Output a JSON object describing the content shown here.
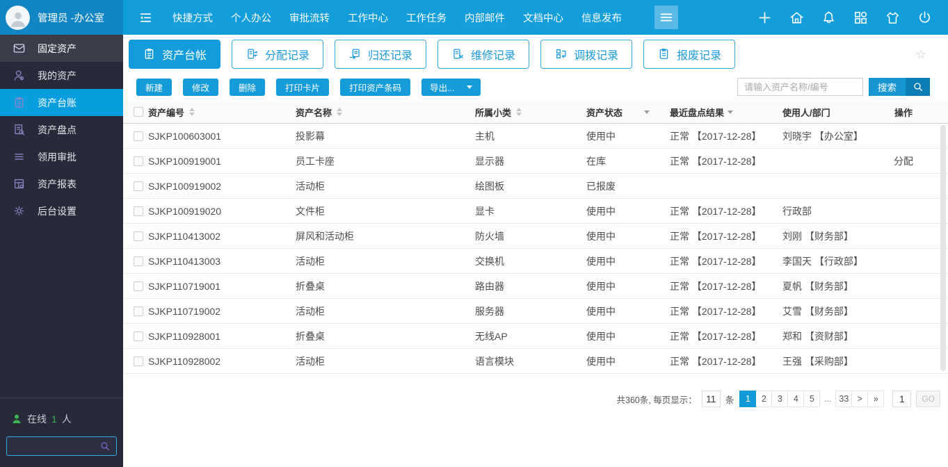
{
  "header": {
    "user_label": "管理员 -办公室",
    "nav": [
      "快捷方式",
      "个人办公",
      "审批流转",
      "工作中心",
      "工作任务",
      "内部邮件",
      "文档中心",
      "信息发布"
    ]
  },
  "sidebar": {
    "items": [
      {
        "label": "固定资产",
        "icon": "mail",
        "header": true
      },
      {
        "label": "我的资产",
        "icon": "user"
      },
      {
        "label": "资产台账",
        "icon": "ledger",
        "active": true
      },
      {
        "label": "资产盘点",
        "icon": "inventory"
      },
      {
        "label": "领用审批",
        "icon": "approval"
      },
      {
        "label": "资产报表",
        "icon": "report"
      },
      {
        "label": "后台设置",
        "icon": "gear"
      }
    ],
    "online_prefix": "在线",
    "online_count": "1",
    "online_suffix": "人"
  },
  "tabs": [
    {
      "label": "资产台帐",
      "icon": "tab-ledger",
      "active": true
    },
    {
      "label": "分配记录",
      "icon": "tab-allocate"
    },
    {
      "label": "归还记录",
      "icon": "tab-return"
    },
    {
      "label": "维修记录",
      "icon": "tab-repair"
    },
    {
      "label": "调拨记录",
      "icon": "tab-transfer"
    },
    {
      "label": "报废记录",
      "icon": "tab-scrap"
    }
  ],
  "misc": {
    "star": "☆"
  },
  "toolbar": {
    "actions": [
      {
        "label": "新建"
      },
      {
        "label": "修改"
      },
      {
        "label": "删除"
      },
      {
        "label": "打印卡片"
      },
      {
        "label": "打印资产条码"
      }
    ],
    "export_label": "导出...",
    "search_placeholder": "请输入资产名称/编号",
    "search_label": "搜索"
  },
  "table": {
    "columns": [
      {
        "label": "资产编号",
        "control": "sort"
      },
      {
        "label": "资产名称",
        "control": "sort"
      },
      {
        "label": "所属小类",
        "control": "sort"
      },
      {
        "label": "资产状态",
        "control": "filter"
      },
      {
        "label": "最近盘点结果",
        "control": "filter"
      },
      {
        "label": "使用人/部门",
        "control": "none"
      },
      {
        "label": "操作",
        "control": "none"
      }
    ],
    "rows": [
      [
        "SJKP100603001",
        "投影幕",
        "主机",
        "使用中",
        "正常 【2017-12-28】",
        "刘晓宇 【办公室】",
        ""
      ],
      [
        "SJKP100919001",
        "员工卡座",
        "显示器",
        "在库",
        "正常 【2017-12-28】",
        "",
        "分配"
      ],
      [
        "SJKP100919002",
        "活动柜",
        "绘图板",
        "已报废",
        "",
        "",
        ""
      ],
      [
        "SJKP100919020",
        "文件柜",
        "显卡",
        "使用中",
        "正常 【2017-12-28】",
        "行政部",
        ""
      ],
      [
        "SJKP110413002",
        "屏风和活动柜",
        "防火墙",
        "使用中",
        "正常 【2017-12-28】",
        "刘刚 【财务部】",
        ""
      ],
      [
        "SJKP110413003",
        "活动柜",
        "交换机",
        "使用中",
        "正常 【2017-12-28】",
        "李国天 【行政部】",
        ""
      ],
      [
        "SJKP110719001",
        "折叠桌",
        "路由器",
        "使用中",
        "正常 【2017-12-28】",
        "夏帆 【财务部】",
        ""
      ],
      [
        "SJKP110719002",
        "活动柜",
        "服务器",
        "使用中",
        "正常 【2017-12-28】",
        "艾雪 【财务部】",
        ""
      ],
      [
        "SJKP110928001",
        "折叠桌",
        "无线AP",
        "使用中",
        "正常 【2017-12-28】",
        "郑和 【资财部】",
        ""
      ],
      [
        "SJKP110928002",
        "活动柜",
        "语言模块",
        "使用中",
        "正常 【2017-12-28】",
        "王强 【采购部】",
        ""
      ]
    ]
  },
  "pagination": {
    "summary_prefix": "共360条, 每页显示：",
    "per_page": "11",
    "per_page_suffix": "条",
    "pages": [
      {
        "label": "1",
        "active": true
      },
      {
        "label": "2"
      },
      {
        "label": "3"
      },
      {
        "label": "4"
      },
      {
        "label": "5"
      },
      {
        "label": "...",
        "plain": true
      },
      {
        "label": "33"
      },
      {
        "label": ">"
      },
      {
        "label": "»"
      }
    ],
    "goto_value": "1",
    "go_label": "GO"
  }
}
